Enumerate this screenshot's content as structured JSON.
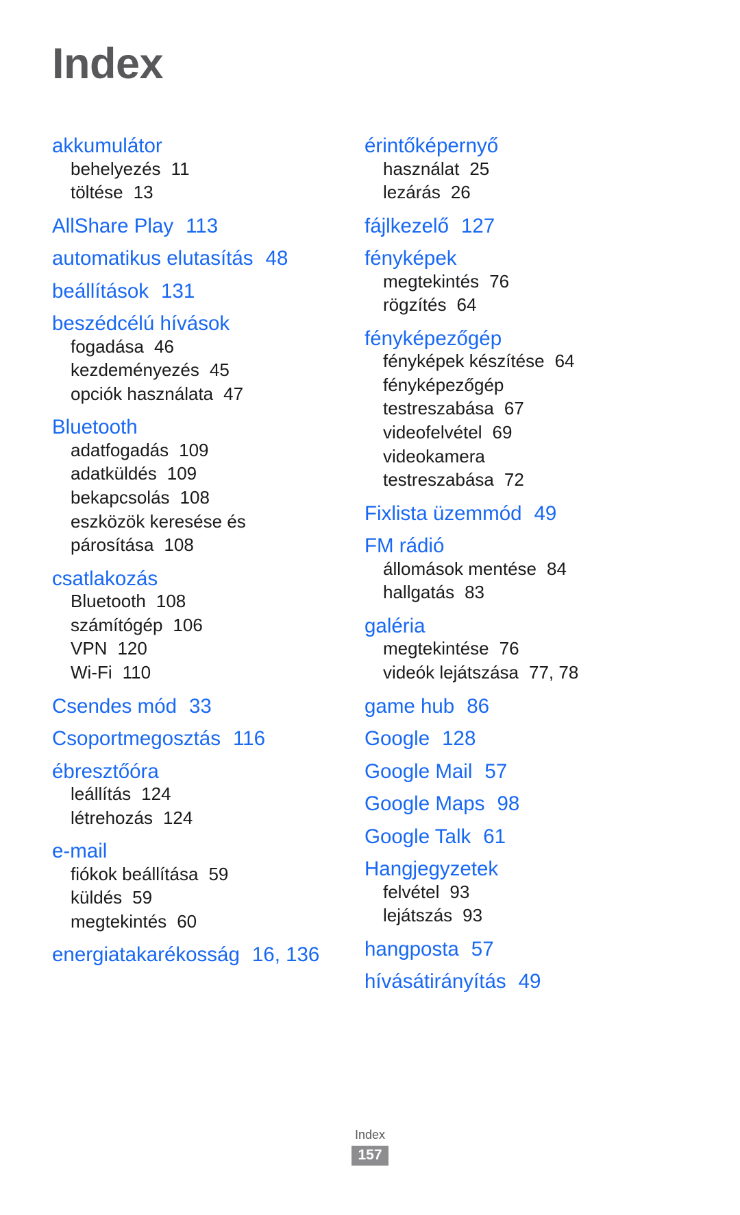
{
  "page": {
    "title": "Index",
    "accent_color": "#1868f2",
    "title_color": "#58585a",
    "footer": {
      "label": "Index",
      "page_number": "157"
    }
  },
  "columns": [
    {
      "id": "left-column",
      "groups": [
        {
          "head": "akkumulátor",
          "head_page": "",
          "subs": [
            {
              "text": "behelyezés",
              "page": "11"
            },
            {
              "text": "töltése",
              "page": "13"
            }
          ]
        },
        {
          "head": "AllShare Play",
          "head_page": "113",
          "subs": []
        },
        {
          "head": "automatikus elutasítás",
          "head_page": "48",
          "subs": []
        },
        {
          "head": "beállítások",
          "head_page": "131",
          "subs": []
        },
        {
          "head": "beszédcélú hívások",
          "head_page": "",
          "subs": [
            {
              "text": "fogadása",
              "page": "46"
            },
            {
              "text": "kezdeményezés",
              "page": "45"
            },
            {
              "text": "opciók használata",
              "page": "47"
            }
          ]
        },
        {
          "head": "Bluetooth",
          "head_page": "",
          "subs": [
            {
              "text": "adatfogadás",
              "page": "109"
            },
            {
              "text": "adatküldés",
              "page": "109"
            },
            {
              "text": "bekapcsolás",
              "page": "108"
            },
            {
              "text": "eszközök keresése és",
              "page": ""
            },
            {
              "text": "párosítása",
              "page": "108"
            }
          ]
        },
        {
          "head": "csatlakozás",
          "head_page": "",
          "subs": [
            {
              "text": "Bluetooth",
              "page": "108"
            },
            {
              "text": "számítógép",
              "page": "106"
            },
            {
              "text": "VPN",
              "page": "120"
            },
            {
              "text": "Wi-Fi",
              "page": "110"
            }
          ]
        },
        {
          "head": "Csendes mód",
          "head_page": "33",
          "subs": []
        },
        {
          "head": "Csoportmegosztás",
          "head_page": "116",
          "subs": []
        },
        {
          "head": "ébresztőóra",
          "head_page": "",
          "subs": [
            {
              "text": "leállítás",
              "page": "124"
            },
            {
              "text": "létrehozás",
              "page": "124"
            }
          ]
        },
        {
          "head": "e-mail",
          "head_page": "",
          "subs": [
            {
              "text": "fiókok beállítása",
              "page": "59"
            },
            {
              "text": "küldés",
              "page": "59"
            },
            {
              "text": "megtekintés",
              "page": "60"
            }
          ]
        },
        {
          "head": "energiatakarékosság",
          "head_page": "16, 136",
          "subs": []
        }
      ]
    },
    {
      "id": "right-column",
      "groups": [
        {
          "head": "érintőképernyő",
          "head_page": "",
          "subs": [
            {
              "text": "használat",
              "page": "25"
            },
            {
              "text": "lezárás",
              "page": "26"
            }
          ]
        },
        {
          "head": "fájlkezelő",
          "head_page": "127",
          "subs": []
        },
        {
          "head": "fényképek",
          "head_page": "",
          "subs": [
            {
              "text": "megtekintés",
              "page": "76"
            },
            {
              "text": "rögzítés",
              "page": "64"
            }
          ]
        },
        {
          "head": "fényképezőgép",
          "head_page": "",
          "subs": [
            {
              "text": "fényképek készítése",
              "page": "64"
            },
            {
              "text": "fényképezőgép",
              "page": ""
            },
            {
              "text": "testreszabása",
              "page": "67"
            },
            {
              "text": "videofelvétel",
              "page": "69"
            },
            {
              "text": "videokamera",
              "page": ""
            },
            {
              "text": "testreszabása",
              "page": "72"
            }
          ]
        },
        {
          "head": "Fixlista üzemmód",
          "head_page": "49",
          "subs": []
        },
        {
          "head": "FM rádió",
          "head_page": "",
          "subs": [
            {
              "text": "állomások mentése",
              "page": "84"
            },
            {
              "text": "hallgatás",
              "page": "83"
            }
          ]
        },
        {
          "head": "galéria",
          "head_page": "",
          "subs": [
            {
              "text": "megtekintése",
              "page": "76"
            },
            {
              "text": "videók lejátszása",
              "page": "77, 78"
            }
          ]
        },
        {
          "head": "game hub",
          "head_page": "86",
          "subs": []
        },
        {
          "head": "Google",
          "head_page": "128",
          "subs": []
        },
        {
          "head": "Google Mail",
          "head_page": "57",
          "subs": []
        },
        {
          "head": "Google Maps",
          "head_page": "98",
          "subs": []
        },
        {
          "head": "Google Talk",
          "head_page": "61",
          "subs": []
        },
        {
          "head": "Hangjegyzetek",
          "head_page": "",
          "subs": [
            {
              "text": "felvétel",
              "page": "93"
            },
            {
              "text": "lejátszás",
              "page": "93"
            }
          ]
        },
        {
          "head": "hangposta",
          "head_page": "57",
          "subs": []
        },
        {
          "head": "hívásátirányítás",
          "head_page": "49",
          "subs": []
        }
      ]
    }
  ]
}
